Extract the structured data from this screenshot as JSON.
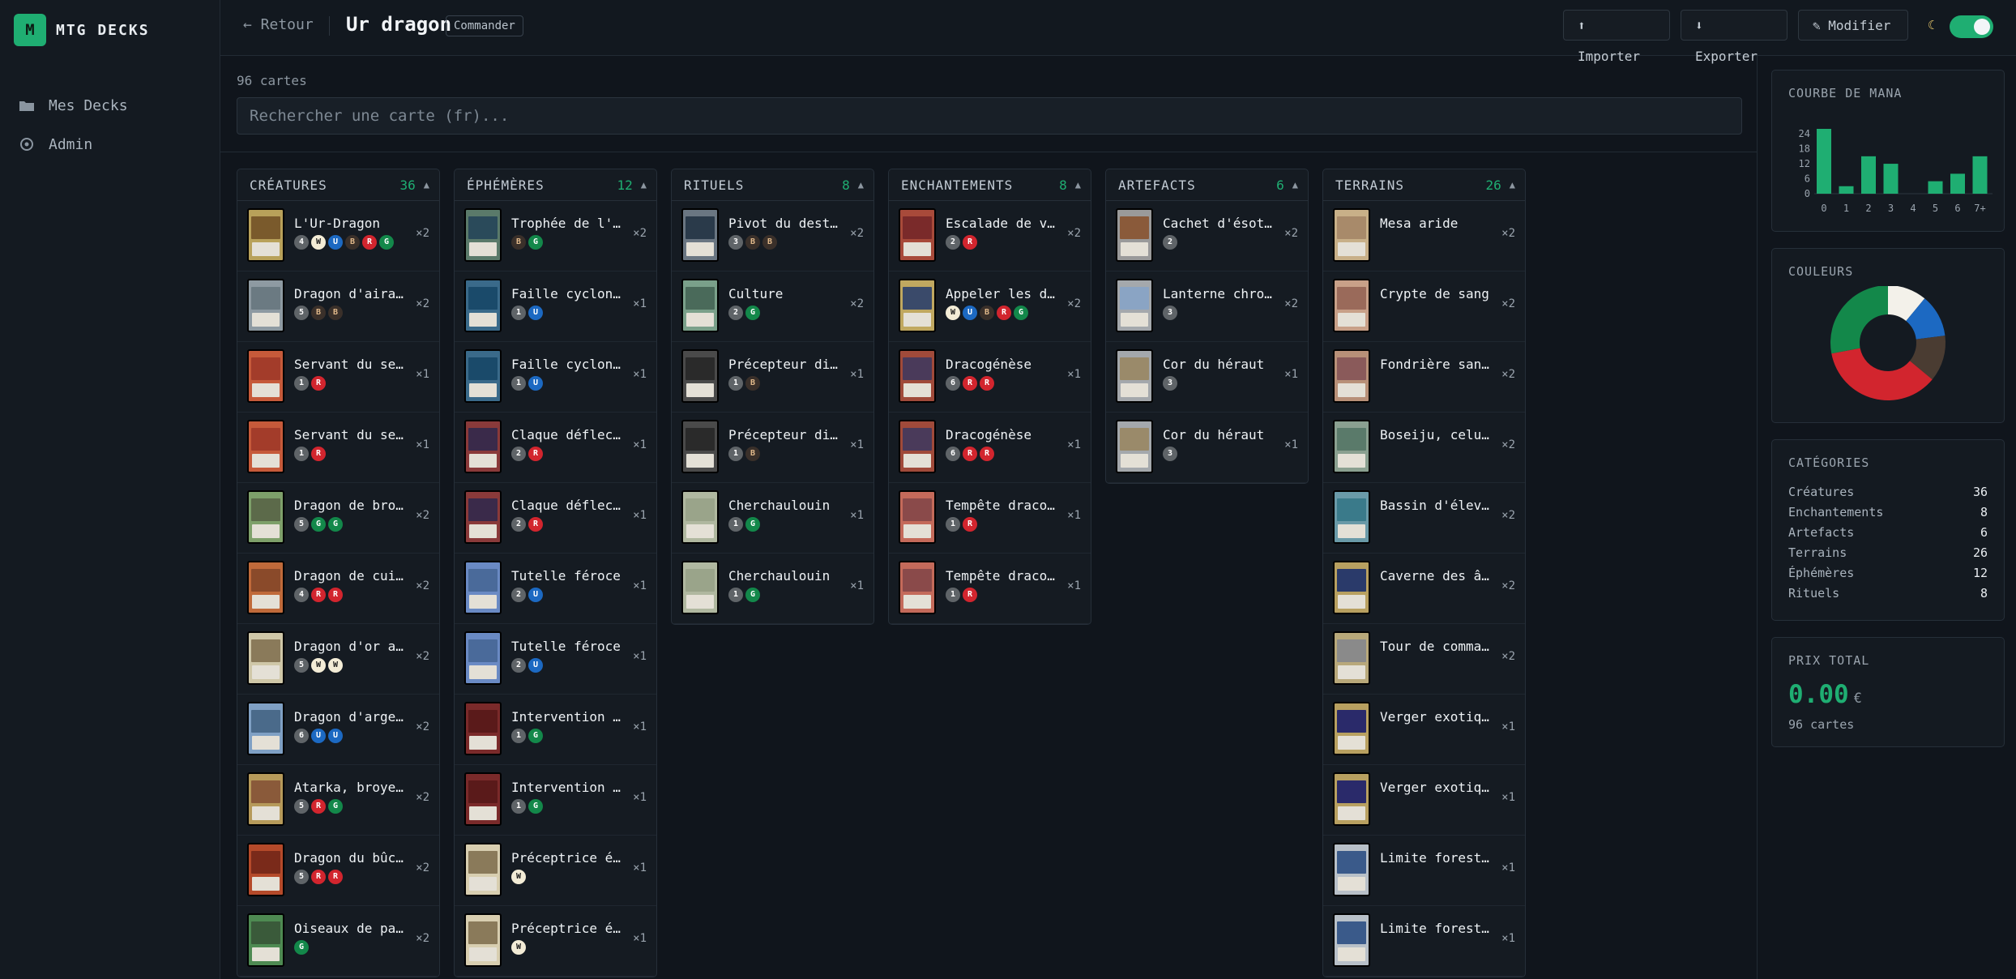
{
  "app": {
    "logo_letter": "M",
    "title": "MTG DECKS"
  },
  "sidebar": {
    "items": [
      {
        "label": "Mes Decks",
        "icon": "folder-icon"
      },
      {
        "label": "Admin",
        "icon": "gear-icon"
      }
    ]
  },
  "topbar": {
    "back_label": "← Retour",
    "deck_name": "Ur dragon",
    "format_badge": "Commander",
    "import_label": "⬆ Importer",
    "export_label": "⬇ Exporter",
    "edit_label": "✎ Modifier",
    "theme_toggle_on": true
  },
  "main": {
    "card_count": "96 cartes",
    "search_placeholder": "Rechercher une carte (fr)..."
  },
  "colors": {
    "accent": "#1fae72",
    "mana": {
      "W": "#f3ecd6",
      "U": "#1c69c2",
      "B": "#3a302a",
      "R": "#d2252e",
      "G": "#13884a",
      "C": "#5f6468"
    }
  },
  "columns": [
    {
      "title": "CRÉATURES",
      "count": "36",
      "cards": [
        {
          "name": "L'Ur-Dragon",
          "cost": [
            "4",
            "W",
            "U",
            "B",
            "R",
            "G"
          ],
          "qty": "×2",
          "art": "#7a5a2c",
          "frame": "#b8a15a"
        },
        {
          "name": "Dragon d'airain",
          "cost": [
            "5",
            "B",
            "B"
          ],
          "qty": "×2",
          "art": "#6b7a82",
          "frame": "#8e9aa2"
        },
        {
          "name": "Servant du seigneur dragon",
          "cost": [
            "1",
            "R"
          ],
          "qty": "×1",
          "art": "#a33c2a",
          "frame": "#c65a3a"
        },
        {
          "name": "Servant du seigneur dragon",
          "cost": [
            "1",
            "R"
          ],
          "qty": "×1",
          "art": "#a33c2a",
          "frame": "#c65a3a"
        },
        {
          "name": "Dragon de bronze",
          "cost": [
            "5",
            "G",
            "G"
          ],
          "qty": "×2",
          "art": "#5c6a4a",
          "frame": "#7ea06a"
        },
        {
          "name": "Dragon de cuivre",
          "cost": [
            "4",
            "R",
            "R"
          ],
          "qty": "×2",
          "art": "#8a4a2a",
          "frame": "#c06a3a"
        },
        {
          "name": "Dragon d'or ancien",
          "cost": [
            "5",
            "W",
            "W"
          ],
          "qty": "×2",
          "art": "#8a7a5a",
          "frame": "#cfc7a8"
        },
        {
          "name": "Dragon d'argent",
          "cost": [
            "6",
            "U",
            "U"
          ],
          "qty": "×2",
          "art": "#4a6a8a",
          "frame": "#7fa0c4"
        },
        {
          "name": "Atarka, broyeur de mondes",
          "cost": [
            "5",
            "R",
            "G"
          ],
          "qty": "×2",
          "art": "#8a5a3a",
          "frame": "#b69a5a"
        },
        {
          "name": "Dragon du bûcher",
          "cost": [
            "5",
            "R",
            "R"
          ],
          "qty": "×2",
          "art": "#7a2a1a",
          "frame": "#b54a2a"
        },
        {
          "name": "Oiseaux de paradis",
          "cost": [
            "G"
          ],
          "qty": "×2",
          "art": "#3a5a3a",
          "frame": "#4e8a52"
        }
      ]
    },
    {
      "title": "ÉPHÉMÈRES",
      "count": "12",
      "cards": [
        {
          "name": "Trophée de l'assassin",
          "cost": [
            "B",
            "G"
          ],
          "qty": "×2",
          "art": "#2a4a5a",
          "frame": "#5a7a6a"
        },
        {
          "name": "Faille cyclonique",
          "cost": [
            "1",
            "U"
          ],
          "qty": "×1",
          "art": "#1a4a6a",
          "frame": "#3a6a8a"
        },
        {
          "name": "Faille cyclonique",
          "cost": [
            "1",
            "U"
          ],
          "qty": "×1",
          "art": "#1a4a6a",
          "frame": "#3a6a8a"
        },
        {
          "name": "Claque déflectrice",
          "cost": [
            "2",
            "R"
          ],
          "qty": "×1",
          "art": "#3a2a4a",
          "frame": "#8a3a3a"
        },
        {
          "name": "Claque déflectrice",
          "cost": [
            "2",
            "R"
          ],
          "qty": "×1",
          "art": "#3a2a4a",
          "frame": "#8a3a3a"
        },
        {
          "name": "Tutelle féroce",
          "cost": [
            "2",
            "U"
          ],
          "qty": "×1",
          "art": "#4a6a9a",
          "frame": "#6a8ac4"
        },
        {
          "name": "Tutelle féroce",
          "cost": [
            "2",
            "U"
          ],
          "qty": "×1",
          "art": "#4a6a9a",
          "frame": "#6a8ac4"
        },
        {
          "name": "Intervention héroïque",
          "cost": [
            "1",
            "G"
          ],
          "qty": "×1",
          "art": "#5a1a1a",
          "frame": "#7a2a2a"
        },
        {
          "name": "Intervention héroïque",
          "cost": [
            "1",
            "G"
          ],
          "qty": "×1",
          "art": "#5a1a1a",
          "frame": "#7a2a2a"
        },
        {
          "name": "Préceptrice écarlate",
          "cost": [
            "W"
          ],
          "qty": "×1",
          "art": "#8a7a5a",
          "frame": "#d8ceb0"
        },
        {
          "name": "Préceptrice écarlate",
          "cost": [
            "W"
          ],
          "qty": "×1",
          "art": "#8a7a5a",
          "frame": "#d8ceb0"
        }
      ]
    },
    {
      "title": "RITUELS",
      "count": "8",
      "cards": [
        {
          "name": "Pivot du destin",
          "cost": [
            "3",
            "B",
            "B"
          ],
          "qty": "×2",
          "art": "#2a3a4a",
          "frame": "#6a7682"
        },
        {
          "name": "Culture",
          "cost": [
            "2",
            "G"
          ],
          "qty": "×2",
          "art": "#4a6a5a",
          "frame": "#7aa08a"
        },
        {
          "name": "Précepteur diabolique",
          "cost": [
            "1",
            "B"
          ],
          "qty": "×1",
          "art": "#2a2a2a",
          "frame": "#4a4a4a"
        },
        {
          "name": "Précepteur diabolique",
          "cost": [
            "1",
            "B"
          ],
          "qty": "×1",
          "art": "#2a2a2a",
          "frame": "#4a4a4a"
        },
        {
          "name": "Cherchaulouin",
          "cost": [
            "1",
            "G"
          ],
          "qty": "×1",
          "art": "#9aa48a",
          "frame": "#b0b8a0"
        },
        {
          "name": "Cherchaulouin",
          "cost": [
            "1",
            "G"
          ],
          "qty": "×1",
          "art": "#9aa48a",
          "frame": "#b0b8a0"
        }
      ]
    },
    {
      "title": "ENCHANTEMENTS",
      "count": "8",
      "cards": [
        {
          "name": "Escalade de violence",
          "cost": [
            "2",
            "R"
          ],
          "qty": "×2",
          "art": "#7a2a2a",
          "frame": "#a84a3a"
        },
        {
          "name": "Appeler les dragons",
          "cost": [
            "W",
            "U",
            "B",
            "R",
            "G"
          ],
          "qty": "×2",
          "art": "#3a4a6a",
          "frame": "#c0a860"
        },
        {
          "name": "Dracogénèse",
          "cost": [
            "6",
            "R",
            "R"
          ],
          "qty": "×1",
          "art": "#4a3a5a",
          "frame": "#a04a3a"
        },
        {
          "name": "Dracogénèse",
          "cost": [
            "6",
            "R",
            "R"
          ],
          "qty": "×1",
          "art": "#4a3a5a",
          "frame": "#a04a3a"
        },
        {
          "name": "Tempête draconique",
          "cost": [
            "1",
            "R"
          ],
          "qty": "×1",
          "art": "#8a4a4a",
          "frame": "#c46a5a"
        },
        {
          "name": "Tempête draconique",
          "cost": [
            "1",
            "R"
          ],
          "qty": "×1",
          "art": "#8a4a4a",
          "frame": "#c46a5a"
        }
      ]
    },
    {
      "title": "ARTEFACTS",
      "count": "6",
      "cards": [
        {
          "name": "Cachet d'ésotérisme",
          "cost": [
            "2"
          ],
          "qty": "×2",
          "art": "#8a5a3a",
          "frame": "#9a9a9a"
        },
        {
          "name": "Lanterne chromatique",
          "cost": [
            "3"
          ],
          "qty": "×2",
          "art": "#8aa4c4",
          "frame": "#a4a8ac"
        },
        {
          "name": "Cor du héraut",
          "cost": [
            "3"
          ],
          "qty": "×1",
          "art": "#9a8a6a",
          "frame": "#a4a8ac"
        },
        {
          "name": "Cor du héraut",
          "cost": [
            "3"
          ],
          "qty": "×1",
          "art": "#9a8a6a",
          "frame": "#a4a8ac"
        }
      ]
    },
    {
      "title": "TERRAINS",
      "count": "26",
      "cards": [
        {
          "name": "Mesa aride",
          "cost": [],
          "qty": "×2",
          "art": "#a88a6a",
          "frame": "#c8b088"
        },
        {
          "name": "Crypte de sang",
          "cost": [],
          "qty": "×2",
          "art": "#9a6a5a",
          "frame": "#c8a088"
        },
        {
          "name": "Fondrière sanglante",
          "cost": [],
          "qty": "×2",
          "art": "#8a5a5a",
          "frame": "#b89078"
        },
        {
          "name": "Boseiju, celui qui abrite",
          "cost": [],
          "qty": "×2",
          "art": "#5a7a6a",
          "frame": "#8aa090"
        },
        {
          "name": "Bassin d'élevage",
          "cost": [],
          "qty": "×2",
          "art": "#3a7a8a",
          "frame": "#6a9aa8"
        },
        {
          "name": "Caverne des âmes",
          "cost": [],
          "qty": "×2",
          "art": "#2a3a6a",
          "frame": "#b8a060"
        },
        {
          "name": "Tour de commandement",
          "cost": [],
          "qty": "×2",
          "art": "#8a8a8a",
          "frame": "#b8a87a"
        },
        {
          "name": "Verger exotique",
          "cost": [],
          "qty": "×1",
          "art": "#2a2a6a",
          "frame": "#b8a060"
        },
        {
          "name": "Verger exotique",
          "cost": [],
          "qty": "×1",
          "art": "#2a2a6a",
          "frame": "#b8a060"
        },
        {
          "name": "Limite forestière",
          "cost": [],
          "qty": "×1",
          "art": "#3a5a8a",
          "frame": "#b8c0c8"
        },
        {
          "name": "Limite forestière",
          "cost": [],
          "qty": "×1",
          "art": "#3a5a8a",
          "frame": "#b8c0c8"
        }
      ]
    }
  ],
  "mana_curve": {
    "title": "COURBE DE MANA",
    "chart_data": {
      "type": "bar",
      "categories": [
        "0",
        "1",
        "2",
        "3",
        "4",
        "5",
        "6",
        "7+"
      ],
      "values": [
        26,
        3,
        15,
        12,
        0,
        5,
        8,
        15
      ],
      "ylim": [
        0,
        26
      ],
      "yticks": [
        "24",
        "18",
        "12",
        "6",
        "0"
      ],
      "color": "#1fae72"
    }
  },
  "colors_panel": {
    "title": "COULEURS",
    "chart_data": {
      "type": "pie",
      "categories": [
        "W",
        "U",
        "B",
        "R",
        "G"
      ],
      "values": [
        11,
        12,
        13,
        36,
        28
      ],
      "colors": [
        "#f3f1ea",
        "#1c69c2",
        "#4a3c32",
        "#d2252e",
        "#13884a"
      ]
    }
  },
  "categories": {
    "title": "CATÉGORIES",
    "rows": [
      {
        "label": "Créatures",
        "value": "36"
      },
      {
        "label": "Enchantements",
        "value": "8"
      },
      {
        "label": "Artefacts",
        "value": "6"
      },
      {
        "label": "Terrains",
        "value": "26"
      },
      {
        "label": "Éphémères",
        "value": "12"
      },
      {
        "label": "Rituels",
        "value": "8"
      }
    ]
  },
  "price": {
    "title": "PRIX TOTAL",
    "value": "0.00",
    "currency": "€",
    "sub": "96 cartes"
  }
}
